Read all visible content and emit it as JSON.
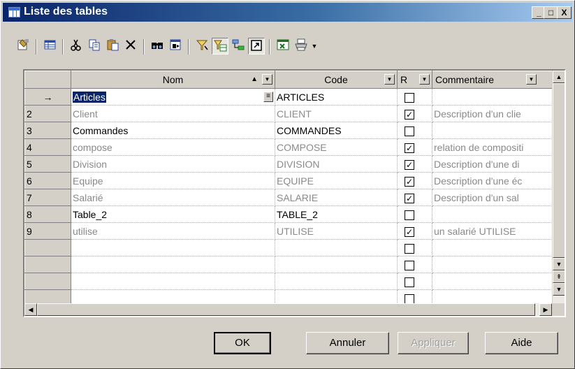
{
  "window": {
    "title": "Liste des tables",
    "controls": [
      "_",
      "□",
      "X"
    ]
  },
  "toolbar": {
    "icons": [
      "properties-icon",
      "customize-columns-icon",
      "cut-icon",
      "copy-icon",
      "paste-icon",
      "delete-icon",
      "find-icon",
      "replace-icon",
      "filter-icon",
      "enable-filter-icon",
      "find-in-diagram-icon",
      "open-properties-icon",
      "export-excel-icon",
      "print-icon",
      "more-dropdown-icon"
    ],
    "pressed": [
      "enable-filter-icon",
      "open-properties-icon"
    ]
  },
  "grid": {
    "columns": [
      {
        "label": "Nom",
        "sort": "▲"
      },
      {
        "label": "Code"
      },
      {
        "label": "R"
      },
      {
        "label": "Commentaire"
      }
    ],
    "rows": [
      {
        "num": "→",
        "nom": "Articles",
        "code": "ARTICLES",
        "r": false,
        "comment": "",
        "dim": false,
        "current": true
      },
      {
        "num": "2",
        "nom": "Client",
        "code": "CLIENT",
        "r": true,
        "comment": "Description d'un clie",
        "dim": true
      },
      {
        "num": "3",
        "nom": "Commandes",
        "code": "COMMANDES",
        "r": false,
        "comment": "",
        "dim": false
      },
      {
        "num": "4",
        "nom": "compose",
        "code": "COMPOSE",
        "r": true,
        "comment": "relation de compositi",
        "dim": true
      },
      {
        "num": "5",
        "nom": "Division",
        "code": "DIVISION",
        "r": true,
        "comment": "Description d'une di",
        "dim": true
      },
      {
        "num": "6",
        "nom": "Equipe",
        "code": "EQUIPE",
        "r": true,
        "comment": "Description d'une éc",
        "dim": true
      },
      {
        "num": "7",
        "nom": "Salarié",
        "code": "SALARIE",
        "r": true,
        "comment": "Description d'un sal",
        "dim": true
      },
      {
        "num": "8",
        "nom": "Table_2",
        "code": "TABLE_2",
        "r": false,
        "comment": "",
        "dim": false
      },
      {
        "num": "9",
        "nom": "utilise",
        "code": "UTILISE",
        "r": true,
        "comment": "un salarié UTILISE",
        "dim": true
      },
      {
        "num": "",
        "nom": "",
        "code": "",
        "r": false,
        "comment": "",
        "dim": false
      },
      {
        "num": "",
        "nom": "",
        "code": "",
        "r": false,
        "comment": "",
        "dim": false
      },
      {
        "num": "",
        "nom": "",
        "code": "",
        "r": false,
        "comment": "",
        "dim": false
      },
      {
        "num": "",
        "nom": "",
        "code": "",
        "r": false,
        "comment": "",
        "dim": false
      }
    ]
  },
  "buttons": {
    "ok": "OK",
    "cancel": "Annuler",
    "apply": "Appliquer",
    "help": "Aide"
  },
  "colors": {
    "titlebar_start": "#0a246a",
    "titlebar_end": "#a6caf0",
    "face": "#d4d0c8",
    "selection": "#0a246a",
    "dim_text": "#8a8a8a"
  }
}
